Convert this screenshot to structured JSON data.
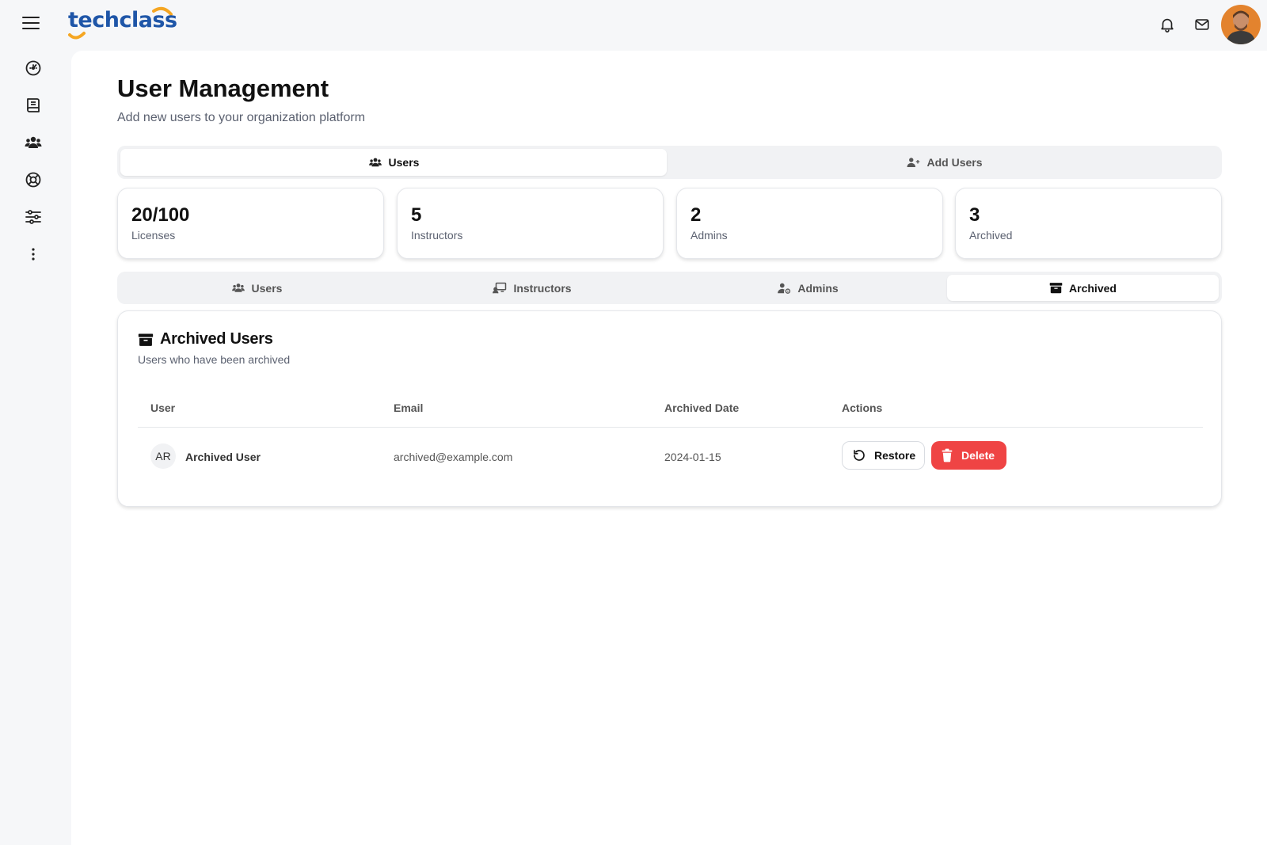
{
  "app": {
    "brand": "techclass",
    "colors": {
      "brand_blue": "#1f56a8",
      "brand_orange": "#f5a623",
      "danger": "#ef4444"
    }
  },
  "topbar": {
    "icons": [
      "menu-icon",
      "bell-icon",
      "mail-icon",
      "avatar"
    ]
  },
  "sidebar": {
    "icons": [
      "dashboard-icon",
      "book-icon",
      "users-icon",
      "support-icon",
      "settings-sliders-icon",
      "more-vertical-icon"
    ]
  },
  "page": {
    "title": "User Management",
    "subtitle": "Add new users to your organization platform"
  },
  "top_tabs": [
    {
      "label": "Users",
      "icon": "users-icon",
      "active": true
    },
    {
      "label": "Add Users",
      "icon": "user-plus-icon",
      "active": false
    }
  ],
  "stats": [
    {
      "value": "20/100",
      "label": "Licenses"
    },
    {
      "value": "5",
      "label": "Instructors"
    },
    {
      "value": "2",
      "label": "Admins"
    },
    {
      "value": "3",
      "label": "Archived"
    }
  ],
  "sub_tabs": [
    {
      "label": "Users",
      "icon": "users-icon",
      "active": false
    },
    {
      "label": "Instructors",
      "icon": "presentation-icon",
      "active": false
    },
    {
      "label": "Admins",
      "icon": "user-cog-icon",
      "active": false
    },
    {
      "label": "Archived",
      "icon": "archive-icon",
      "active": true
    }
  ],
  "panel": {
    "title": "Archived Users",
    "subtitle": "Users who have been archived",
    "columns": [
      "User",
      "Email",
      "Archived Date",
      "Actions"
    ],
    "rows": [
      {
        "initials": "AR",
        "name": "Archived User",
        "email": "archived@example.com",
        "date": "2024-01-15"
      }
    ],
    "restore_label": "Restore",
    "delete_label": "Delete"
  }
}
